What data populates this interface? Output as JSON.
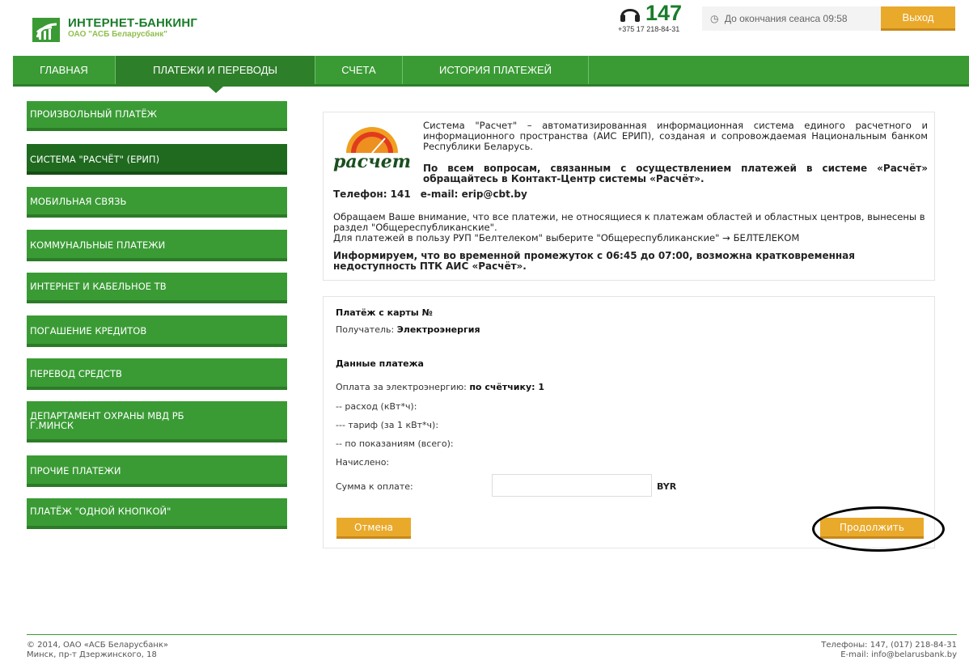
{
  "header": {
    "brand_title": "ИНТЕРНЕТ-БАНКИНГ",
    "brand_subtitle": "ОАО \"АСБ Беларусбанк\"",
    "phone_short": "147",
    "phone_full": "+375 17 218-84-31",
    "session_text": "До окончания сеанса 09:58",
    "logout_label": "Выход"
  },
  "nav": {
    "items": [
      "ГЛАВНАЯ",
      "ПЛАТЕЖИ И ПЕРЕВОДЫ",
      "СЧЕТА",
      "ИСТОРИЯ ПЛАТЕЖЕЙ"
    ],
    "active": "ПЛАТЕЖИ И ПЕРЕВОДЫ"
  },
  "sidebar": {
    "items": [
      "ПРОИЗВОЛЬНЫЙ ПЛАТЁЖ",
      "СИСТЕМА \"РАСЧЁТ\" (ЕРИП)",
      "МОБИЛЬНАЯ СВЯЗЬ",
      "КОММУНАЛЬНЫЕ ПЛАТЕЖИ",
      "ИНТЕРНЕТ И КАБЕЛЬНОЕ ТВ",
      "ПОГАШЕНИЕ КРЕДИТОВ",
      "ПЕРЕВОД СРЕДСТВ",
      "ДЕПАРТАМЕНТ ОХРАНЫ МВД РБ",
      "ПРОЧИЕ ПЛАТЕЖИ",
      "ПЛАТЁЖ \"ОДНОЙ КНОПКОЙ\""
    ],
    "item8_line2": "Г.МИНСК",
    "active": "СИСТЕМА \"РАСЧЁТ\" (ЕРИП)"
  },
  "info": {
    "logo_text": "расчет",
    "text1": "Система \"Расчет\" – автоматизированная информационная система единого расчетного и информационного пространства (АИС ЕРИП), созданая и сопровождаемая Национальным банком Республики Беларусь.",
    "text2": "По всем вопросам, связанным с осуществлением платежей в системе «Расчёт» обращайтесь в Контакт-Центр системы «Расчёт».",
    "phone": "Телефон: 141",
    "email": "e-mail: erip@cbt.by",
    "note1": "Обращаем Ваше внимание, что все платежи, не относящиеся к платежам областей и областных центров, вынесены в раздел \"Общереспубликанские\".",
    "note2": "Для платежей в пользу РУП \"Белтелеком\" выберите \"Общереспубликанские\" → БЕЛТЕЛЕКОМ",
    "bold_note": "Информируем, что во временной промежуток с 06:45 до 07:00, возможна кратковременная недоступность ПТК АИС «Расчёт»."
  },
  "form": {
    "card_label": "Платёж с карты №",
    "recipient_label": "Получатель:",
    "recipient_value": "Электроэнергия",
    "section_title": "Данные платежа",
    "payment_label": "Оплата за электроэнергию:",
    "payment_value": "по счётчику: 1",
    "row_consumption": "-- расход (кВт*ч):",
    "row_tariff": "--- тариф (за 1 кВт*ч):",
    "row_total": "-- по показаниям (всего):",
    "row_charged": "Начислено:",
    "amount_label": "Сумма к оплате:",
    "amount_value": "",
    "currency": "BYR",
    "cancel_label": "Отмена",
    "continue_label": "Продолжить"
  },
  "footer": {
    "copyright": "© 2014, ОАО «АСБ Беларусбанк»",
    "address": "Минск, пр-т Дзержинского, 18",
    "phones": "Телефоны: 147, (017) 218-84-31",
    "email": "E-mail: info@belarusbank.by"
  },
  "colors": {
    "brand_green": "#3a9b35",
    "dark_green": "#1f6a1f",
    "accent_orange": "#e9a92b"
  }
}
